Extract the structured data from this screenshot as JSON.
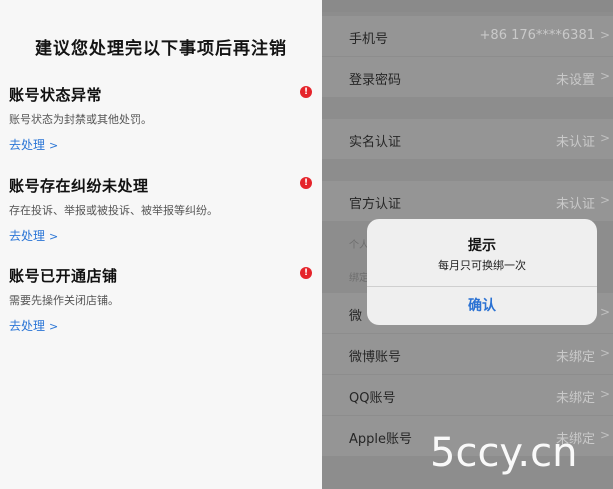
{
  "left": {
    "title": "建议您处理完以下事项后再注销",
    "issues": [
      {
        "title": "账号状态异常",
        "desc": "账号状态为封禁或其他处罚。",
        "link": "去处理",
        "link_chevron": ">",
        "alert": "!"
      },
      {
        "title": "账号存在纠纷未处理",
        "desc": "存在投诉、举报或被投诉、被举报等纠纷。",
        "link": "去处理",
        "link_chevron": ">",
        "alert": "!"
      },
      {
        "title": "账号已开通店铺",
        "desc": "需要先操作关闭店铺。",
        "link": "去处理",
        "link_chevron": ">",
        "alert": "!"
      }
    ]
  },
  "right": {
    "rows": [
      {
        "label": "手机号",
        "value": "+86 176****6381",
        "chevron": ">"
      },
      {
        "label": "登录密码",
        "value": "未设置",
        "chevron": ">"
      },
      {
        "label": "实名认证",
        "value": "未认证",
        "chevron": ">"
      },
      {
        "label": "官方认证",
        "value": "未认证",
        "chevron": ">"
      },
      {
        "label": "微",
        "value": "",
        "chevron": ">"
      },
      {
        "label": "微博账号",
        "value": "未绑定",
        "chevron": ">"
      },
      {
        "label": "QQ账号",
        "value": "未绑定",
        "chevron": ">"
      },
      {
        "label": "Apple账号",
        "value": "未绑定",
        "chevron": ">"
      }
    ],
    "section_headers": [
      "个人",
      "绑定"
    ]
  },
  "dialog": {
    "title": "提示",
    "message": "每月只可换绑一次",
    "confirm": "确认"
  },
  "watermark": "5ccy.cn",
  "colors": {
    "accent": "#2b76d6",
    "alert": "#e5242b",
    "overlay_bg": "#8d8d8d"
  }
}
